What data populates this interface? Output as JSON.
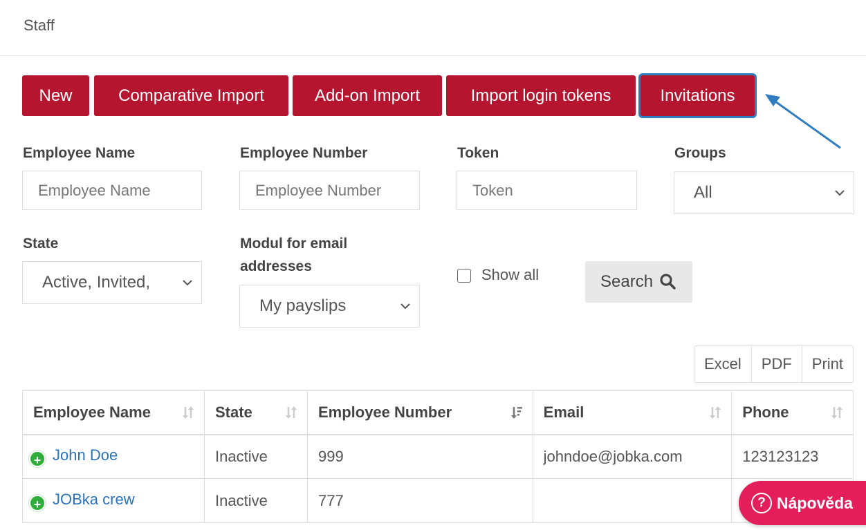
{
  "header": {
    "title": "Staff"
  },
  "toolbar": {
    "new_label": "New",
    "comparative_import_label": "Comparative Import",
    "addon_import_label": "Add-on Import",
    "import_tokens_label": "Import login tokens",
    "invitations_label": "Invitations"
  },
  "filters": {
    "employee_name": {
      "label": "Employee Name",
      "placeholder": "Employee Name"
    },
    "employee_number": {
      "label": "Employee Number",
      "placeholder": "Employee Number"
    },
    "token": {
      "label": "Token",
      "placeholder": "Token"
    },
    "groups": {
      "label": "Groups",
      "value": "All"
    },
    "state": {
      "label": "State",
      "value": "Active, Invited,"
    },
    "modul": {
      "label_line1": "Modul for email",
      "label_line2": "addresses",
      "value": "My payslips"
    },
    "show_all_label": "Show all",
    "search_label": "Search"
  },
  "export": {
    "excel": "Excel",
    "pdf": "PDF",
    "print": "Print"
  },
  "table": {
    "columns": [
      "Employee Name",
      "State",
      "Employee Number",
      "Email",
      "Phone"
    ],
    "rows": [
      {
        "name": "John Doe",
        "state": "Inactive",
        "number": "999",
        "email": "johndoe@jobka.com",
        "phone": "123123123"
      },
      {
        "name": "JOBka crew",
        "state": "Inactive",
        "number": "777",
        "email": "",
        "phone": ""
      }
    ]
  },
  "help": {
    "label": "Nápověda"
  },
  "colors": {
    "primary": "#b5152f",
    "link": "#2a73b8",
    "help": "#e41e5b",
    "highlight": "#2f7dc0"
  }
}
